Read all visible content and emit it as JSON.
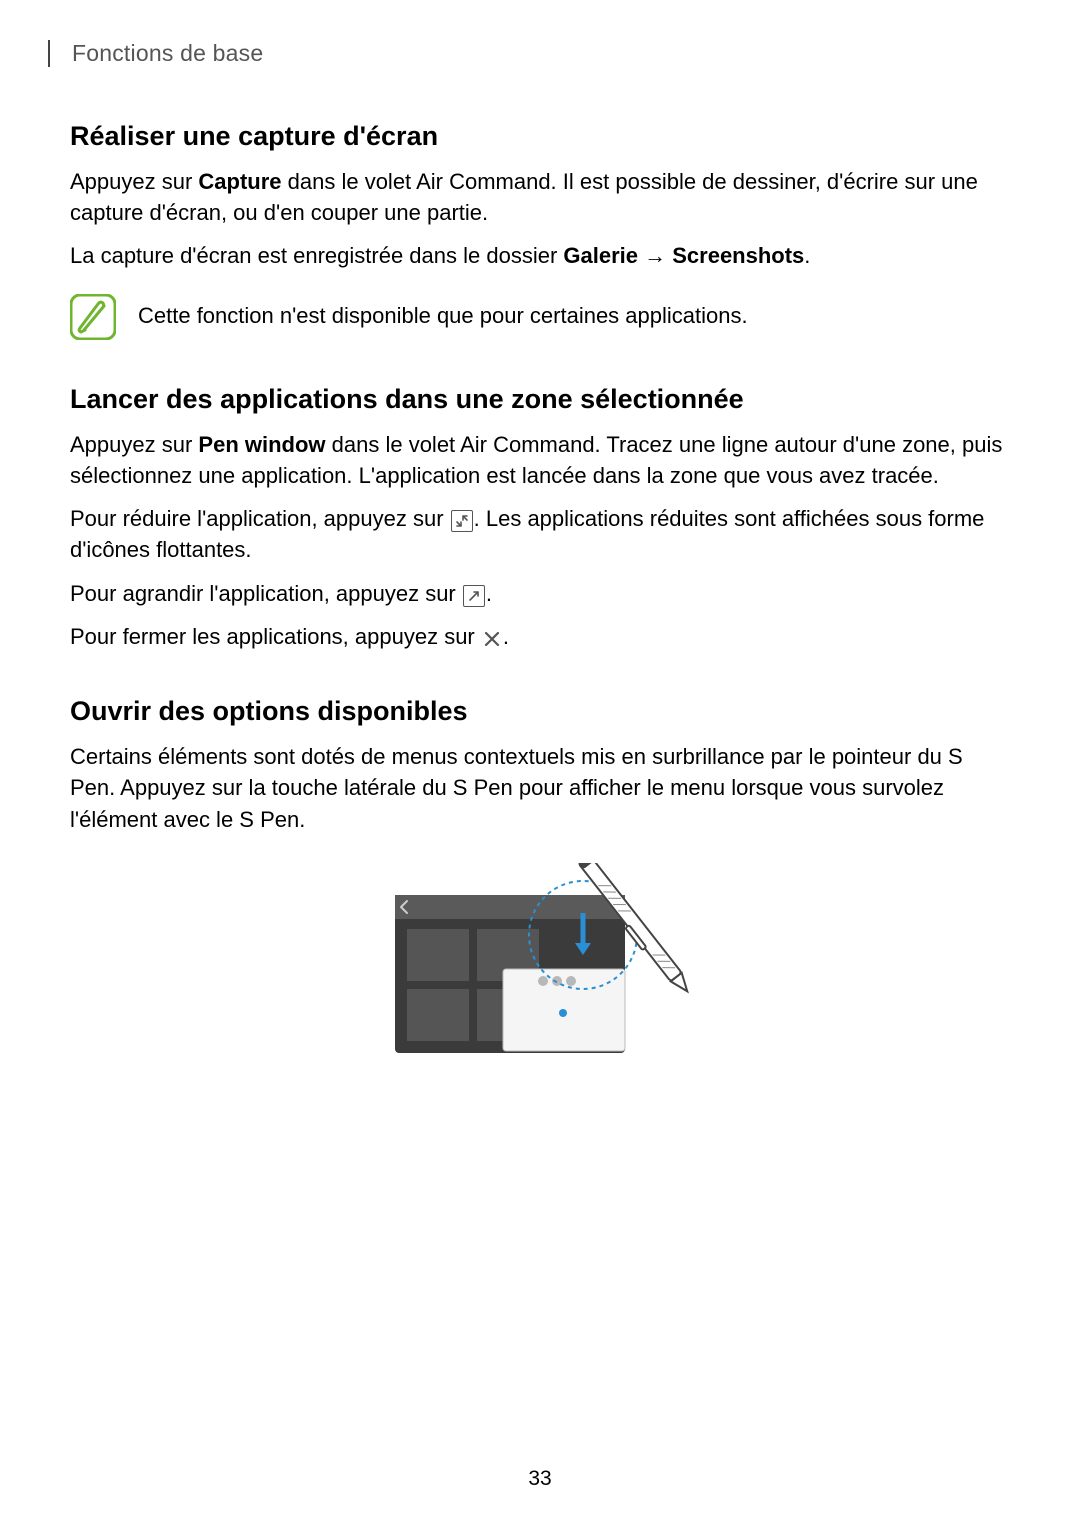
{
  "header": {
    "chapter": "Fonctions de base"
  },
  "section1": {
    "heading": "Réaliser une capture d'écran",
    "p1a": "Appuyez sur ",
    "p1b_bold": "Capture",
    "p1c": " dans le volet Air Command. Il est possible de dessiner, d'écrire sur une capture d'écran, ou d'en couper une partie.",
    "p2a": "La capture d'écran est enregistrée dans le dossier ",
    "p2b_bold": "Galerie",
    "p2c": " → ",
    "p2d_bold": "Screenshots",
    "p2e": ".",
    "note": "Cette fonction n'est disponible que pour certaines applications."
  },
  "section2": {
    "heading": "Lancer des applications dans une zone sélectionnée",
    "p1a": "Appuyez sur ",
    "p1b_bold": "Pen window",
    "p1c": " dans le volet Air Command. Tracez une ligne autour d'une zone, puis sélectionnez une application. L'application est lancée dans la zone que vous avez tracée.",
    "p2a": "Pour réduire l'application, appuyez sur ",
    "p2b": ". Les applications réduites sont affichées sous forme d'icônes flottantes.",
    "p3a": "Pour agrandir l'application, appuyez sur ",
    "p3b": ".",
    "p4a": "Pour fermer les applications, appuyez sur ",
    "p4b": "."
  },
  "section3": {
    "heading": "Ouvrir des options disponibles",
    "p1": "Certains éléments sont dotés de menus contextuels mis en surbrillance par le pointeur du S Pen. Appuyez sur la touche latérale du S Pen pour afficher le menu lorsque vous survolez l'élément avec le S Pen."
  },
  "footer": {
    "page_number": "33"
  }
}
